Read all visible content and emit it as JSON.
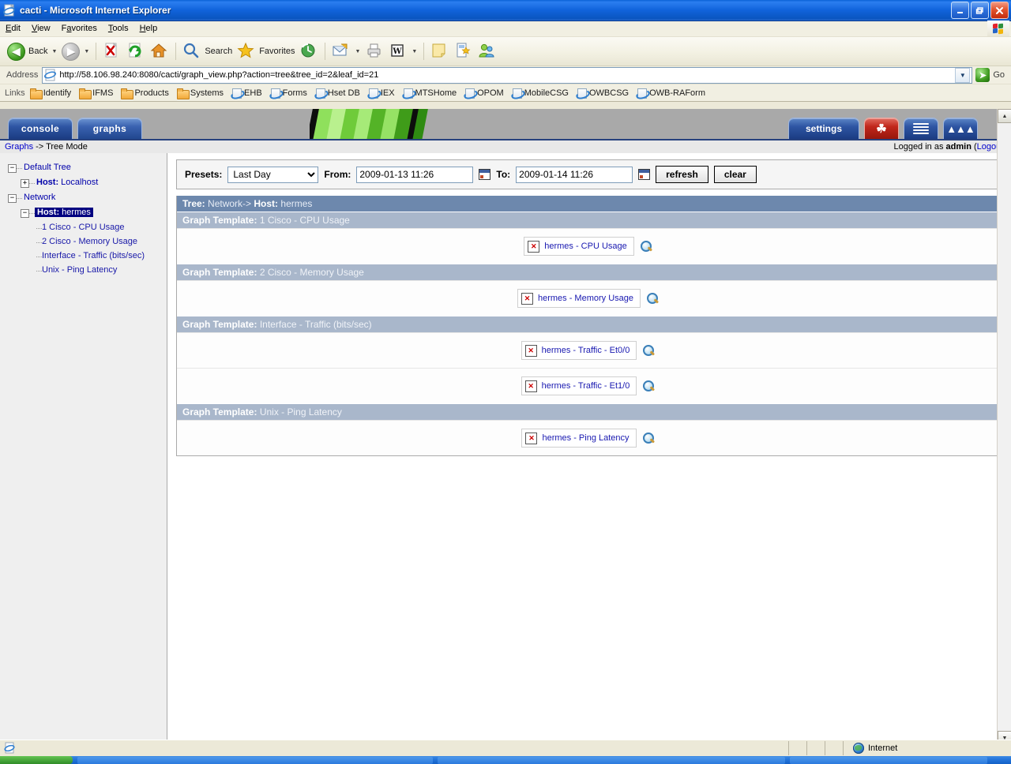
{
  "window": {
    "title": "cacti - Microsoft Internet Explorer",
    "icon": "ie-document-icon",
    "buttons": {
      "minimize": "_",
      "restore": "❐",
      "close": "✕"
    }
  },
  "menubar": {
    "items": [
      {
        "label": "Edit",
        "name": "menu-edit"
      },
      {
        "label": "View",
        "name": "menu-view"
      },
      {
        "label": "Favorites",
        "name": "menu-favorites"
      },
      {
        "label": "Tools",
        "name": "menu-tools"
      },
      {
        "label": "Help",
        "name": "menu-help"
      }
    ]
  },
  "toolbar": {
    "back": "Back",
    "search": "Search",
    "favorites": "Favorites",
    "dropdown_arrow": "▼",
    "icons": [
      "back-arrow-icon",
      "back-dropdown-icon",
      "forward-arrow-icon",
      "forward-dropdown-icon",
      "stop-icon",
      "refresh-icon",
      "home-icon",
      "search-icon",
      "favorites-star-icon",
      "history-icon",
      "mail-icon",
      "mail-dropdown-icon",
      "print-icon",
      "edit-word-icon",
      "edit-dropdown-icon",
      "notes-icon",
      "research-icon",
      "messenger-icon"
    ]
  },
  "address": {
    "label": "Address",
    "url": "http://58.106.98.240:8080/cacti/graph_view.php?action=tree&tree_id=2&leaf_id=21",
    "go_label": "Go",
    "dropdown_arrow": "▼"
  },
  "links": {
    "label": "Links",
    "items": [
      {
        "label": "Identify",
        "icon": "folder-icon"
      },
      {
        "label": "IFMS",
        "icon": "folder-icon"
      },
      {
        "label": "Products",
        "icon": "folder-icon"
      },
      {
        "label": "Systems",
        "icon": "folder-icon"
      },
      {
        "label": "EHB",
        "icon": "ie-page-icon"
      },
      {
        "label": "Forms",
        "icon": "ie-page-icon"
      },
      {
        "label": "Hset DB",
        "icon": "ie-page-icon"
      },
      {
        "label": "IEX",
        "icon": "ie-page-icon"
      },
      {
        "label": "MTSHome",
        "icon": "ie-page-icon"
      },
      {
        "label": "OPOM",
        "icon": "ie-page-icon"
      },
      {
        "label": "MobileCSG",
        "icon": "ie-page-icon"
      },
      {
        "label": "OWBCSG",
        "icon": "ie-page-icon"
      },
      {
        "label": "OWB-RAForm",
        "icon": "ie-page-icon"
      }
    ]
  },
  "cacti": {
    "tabs": [
      {
        "label": "console",
        "name": "tab-console",
        "active": false
      },
      {
        "label": "graphs",
        "name": "tab-graphs",
        "active": true
      }
    ],
    "right_tabs": [
      {
        "label": "settings",
        "name": "tab-settings",
        "kind": "wide"
      },
      {
        "label": "",
        "name": "tab-tree-view",
        "kind": "red",
        "icon": "tree-icon"
      },
      {
        "label": "",
        "name": "tab-list-view",
        "kind": "sq",
        "icon": "list-icon"
      },
      {
        "label": "",
        "name": "tab-preview-view",
        "kind": "sq",
        "icon": "mountains-icon"
      }
    ],
    "breadcrumb_link": "Graphs",
    "breadcrumb_rest": " -> Tree Mode",
    "login_prefix": "Logged in as ",
    "login_user": "admin",
    "logout_open": " (",
    "logout_label": "Logout",
    "logout_close": ")"
  },
  "tree": {
    "nodes": [
      {
        "label": "Default Tree",
        "bold_prefix": "",
        "toggle": "-",
        "depth": 0,
        "selected": false,
        "leaf": false
      },
      {
        "label": "Localhost",
        "bold_prefix": "Host:",
        "toggle": "+",
        "depth": 1,
        "selected": false,
        "leaf": false
      },
      {
        "label": "Network",
        "bold_prefix": "",
        "toggle": "-",
        "depth": 0,
        "selected": false,
        "leaf": false
      },
      {
        "label": "hermes",
        "bold_prefix": "Host:",
        "toggle": "-",
        "depth": 1,
        "selected": true,
        "leaf": false
      },
      {
        "label": "1 Cisco - CPU Usage",
        "bold_prefix": "",
        "toggle": "",
        "depth": 2,
        "selected": false,
        "leaf": true
      },
      {
        "label": "2 Cisco - Memory Usage",
        "bold_prefix": "",
        "toggle": "",
        "depth": 2,
        "selected": false,
        "leaf": true
      },
      {
        "label": "Interface - Traffic (bits/sec)",
        "bold_prefix": "",
        "toggle": "",
        "depth": 2,
        "selected": false,
        "leaf": true
      },
      {
        "label": "Unix - Ping Latency",
        "bold_prefix": "",
        "toggle": "",
        "depth": 2,
        "selected": false,
        "leaf": true
      }
    ]
  },
  "filter": {
    "presets_label": "Presets:",
    "presets_value": "Last Day",
    "presets_options": [
      "Last Day"
    ],
    "from_label": "From:",
    "from_value": "2009-01-13 11:26",
    "to_label": "To:",
    "to_value": "2009-01-14 11:26",
    "refresh_label": "refresh",
    "clear_label": "clear",
    "calendar_icon": "calendar-icon"
  },
  "graphs": {
    "tree_header_label": "Tree:",
    "tree_header_value": "Network->",
    "tree_header_host_label": "Host:",
    "tree_header_host_value": "hermes",
    "template_label": "Graph Template:",
    "broken_mark": "✕",
    "zoom_icon": "magnifier-icon",
    "sections": [
      {
        "template": "1 Cisco - CPU Usage",
        "items": [
          {
            "alt": "hermes - CPU Usage"
          }
        ]
      },
      {
        "template": "2 Cisco - Memory Usage",
        "items": [
          {
            "alt": "hermes - Memory Usage"
          }
        ]
      },
      {
        "template": "Interface - Traffic (bits/sec)",
        "items": [
          {
            "alt": "hermes - Traffic - Et0/0"
          },
          {
            "alt": "hermes - Traffic - Et1/0"
          }
        ]
      },
      {
        "template": "Unix - Ping Latency",
        "items": [
          {
            "alt": "hermes - Ping Latency"
          }
        ]
      }
    ]
  },
  "statusbar": {
    "zone": "Internet",
    "zone_icon": "internet-globe-icon",
    "page_icon": "page-icon"
  },
  "colors": {
    "title_blue": "#0a55c0",
    "tree_header": "#6d88ad",
    "template_header": "#a9b7cb",
    "link_blue": "#0000cc",
    "selected_node": "#000080",
    "broken_red": "#cc0000",
    "cacti_banner_grey": "#a9a9a9",
    "cacti_green": "#6abf3c"
  }
}
